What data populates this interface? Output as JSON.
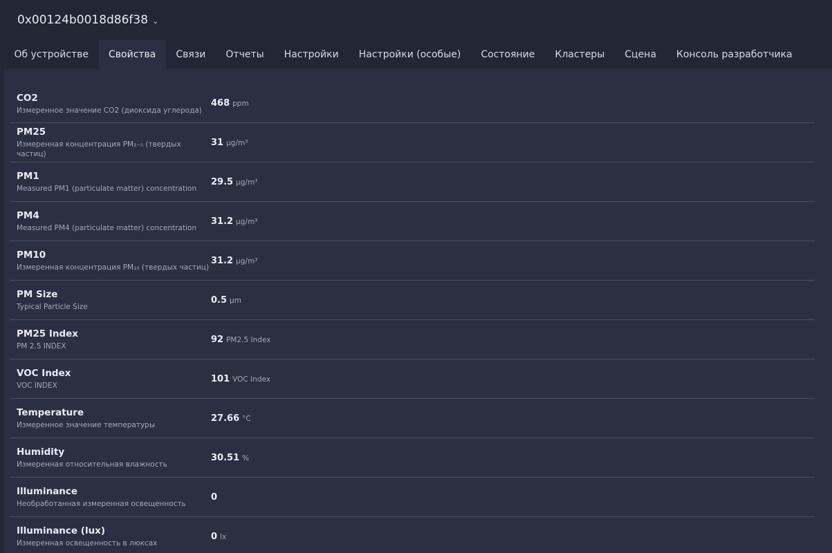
{
  "header": {
    "device_address": "0x00124b0018d86f38",
    "chevron": "⌄"
  },
  "tabs": [
    {
      "label": "Об устройстве",
      "active": false
    },
    {
      "label": "Свойства",
      "active": true
    },
    {
      "label": "Связи",
      "active": false
    },
    {
      "label": "Отчеты",
      "active": false
    },
    {
      "label": "Настройки",
      "active": false
    },
    {
      "label": "Настройки (особые)",
      "active": false
    },
    {
      "label": "Состояние",
      "active": false
    },
    {
      "label": "Кластеры",
      "active": false
    },
    {
      "label": "Сцена",
      "active": false
    },
    {
      "label": "Консоль разработчика",
      "active": false
    }
  ],
  "properties": [
    {
      "name": "CO2",
      "description": "Измеренное значение CO2 (диоксида углерода)",
      "value": "468",
      "unit": "ppm"
    },
    {
      "name": "PM25",
      "description": "Измеренная концентрация PM₂₋₅ (твердых частиц)",
      "value": "31",
      "unit": "µg/m³"
    },
    {
      "name": "PM1",
      "description": "Measured PM1 (particulate matter) concentration",
      "value": "29.5",
      "unit": "µg/m³"
    },
    {
      "name": "PM4",
      "description": "Measured PM4 (particulate matter) concentration",
      "value": "31.2",
      "unit": "µg/m³"
    },
    {
      "name": "PM10",
      "description": "Измеренная концентрация PM₁₀ (твердых частиц)",
      "value": "31.2",
      "unit": "µg/m³"
    },
    {
      "name": "PM Size",
      "description": "Typical Particle Size",
      "value": "0.5",
      "unit": "µm"
    },
    {
      "name": "PM25 Index",
      "description": "PM 2.5 INDEX",
      "value": "92",
      "unit": "PM2.5 Index"
    },
    {
      "name": "VOC Index",
      "description": "VOC INDEX",
      "value": "101",
      "unit": "VOC Index"
    },
    {
      "name": "Temperature",
      "description": "Измеренное значение температуры",
      "value": "27.66",
      "unit": "°C"
    },
    {
      "name": "Humidity",
      "description": "Измеренная относительная влажность",
      "value": "30.51",
      "unit": "%"
    },
    {
      "name": "Illuminance",
      "description": "Необработанная измеренная освещенность",
      "value": "0",
      "unit": ""
    },
    {
      "name": "Illuminance (lux)",
      "description": "Измеренная освещенность в люксах",
      "value": "0",
      "unit": "lx"
    }
  ]
}
